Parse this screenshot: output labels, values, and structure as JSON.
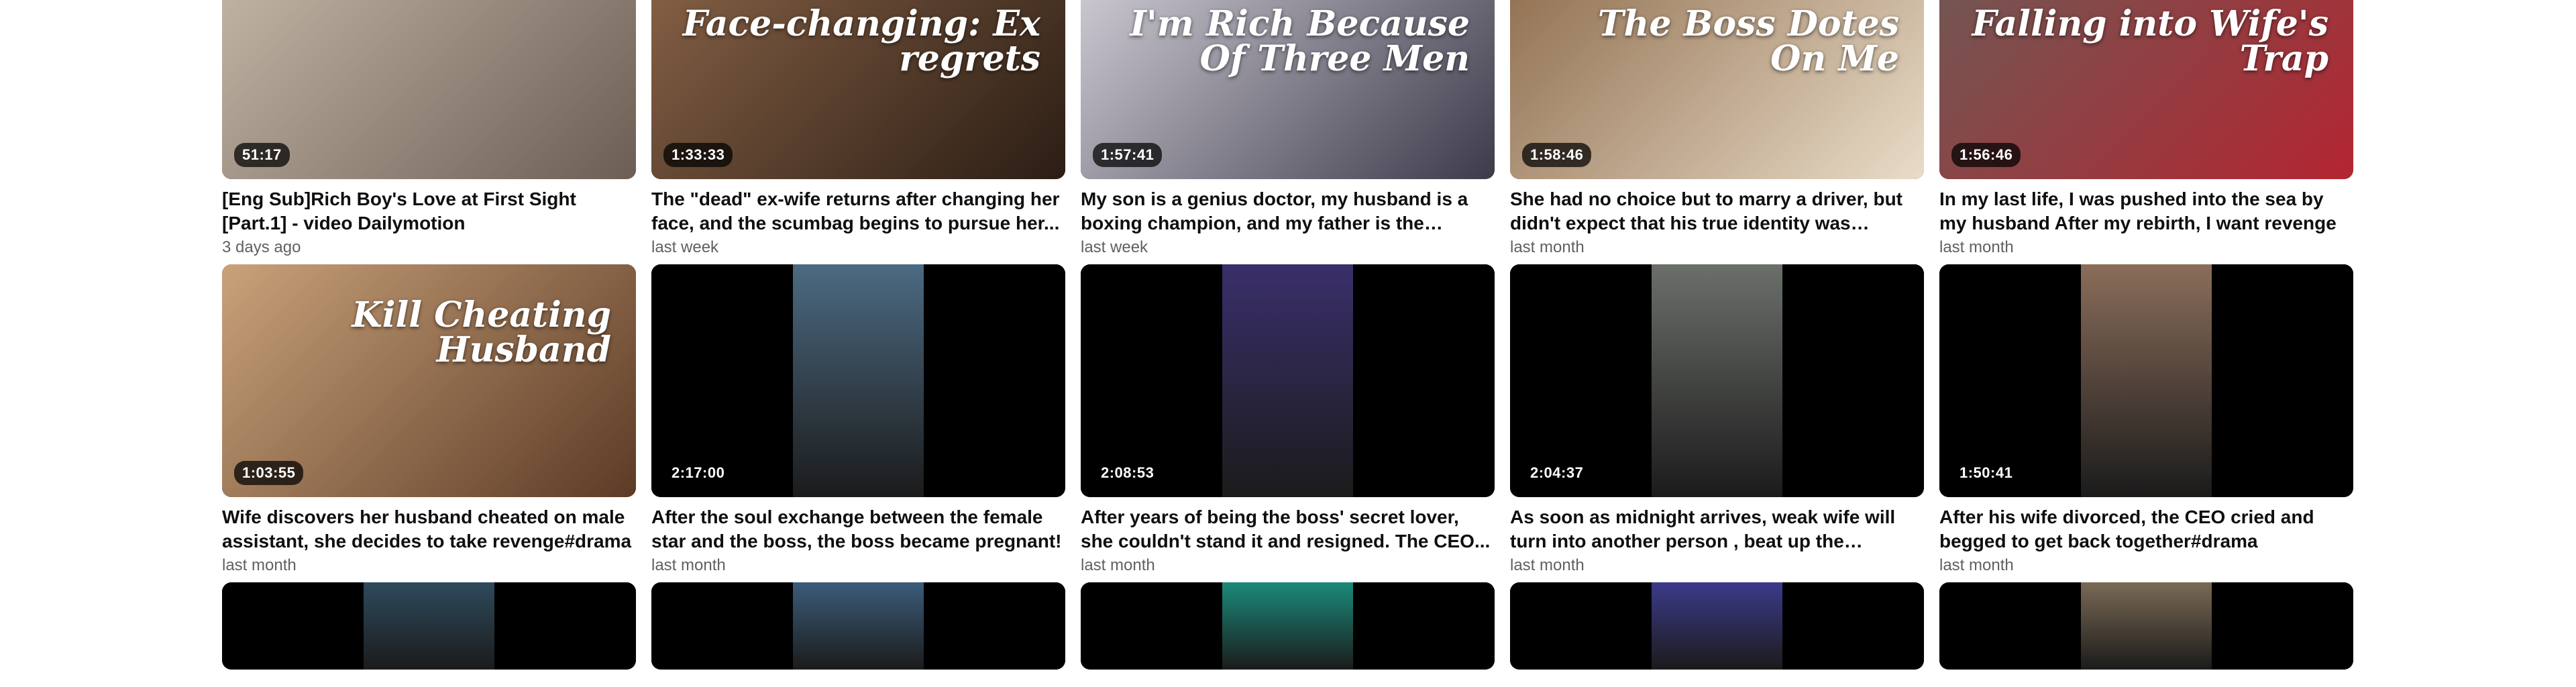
{
  "rows": [
    {
      "cards": [
        {
          "duration": "51:17",
          "title": "[Eng Sub]Rich Boy's Love at First Sight [Part.1] - video Dailymotion",
          "age": "3 days ago",
          "bg": "#c6b9a9",
          "accent": "#6d5e55",
          "overlay": ""
        },
        {
          "duration": "1:33:33",
          "title": "The \"dead\" ex-wife returns after changing her face, and the scumbag begins to pursue her...",
          "age": "last week",
          "bg": "#8a6448",
          "accent": "#2b1d14",
          "overlay": "Face-changing: Ex regrets"
        },
        {
          "duration": "1:57:41",
          "title": "My son is a genius doctor, my husband is a boxing champion, and my father is the richest...",
          "age": "last week",
          "bg": "#d6d3dc",
          "accent": "#3d3a4a",
          "overlay": "I'm Rich Because Of Three Men"
        },
        {
          "duration": "1:58:46",
          "title": "She had no choice but to marry a driver, but didn't expect that his true identity was riches...",
          "age": "last month",
          "bg": "#8c6a4a",
          "accent": "#e9dcc8",
          "overlay": "The Boss Dotes On Me"
        },
        {
          "duration": "1:56:46",
          "title": "In my last life, I was pushed into the sea by my husband After my rebirth, I want revenge",
          "age": "last month",
          "bg": "#6e5a55",
          "accent": "#b32531",
          "overlay": "Falling into Wife's Trap"
        }
      ]
    },
    {
      "cards": [
        {
          "duration": "1:03:55",
          "title": "Wife discovers her husband cheated on male assistant, she decides to take revenge#drama",
          "age": "last month",
          "bg": "#c9a27a",
          "accent": "#5c3b26",
          "overlay": "Kill Cheating Husband"
        },
        {
          "duration": "2:17:00",
          "title": "After the soul exchange between the female star and the boss, the boss became pregnant!",
          "age": "last month",
          "bg": "#000000",
          "accent": "#4b6a82",
          "overlay": ""
        },
        {
          "duration": "2:08:53",
          "title": "After years of being the boss' secret lover, she couldn't stand it and resigned. The CEO...",
          "age": "last month",
          "bg": "#000000",
          "accent": "#3a2f6b",
          "overlay": ""
        },
        {
          "duration": "2:04:37",
          "title": "As soon as midnight arrives, weak wife will turn into another person , beat up the scumbag ex...",
          "age": "last month",
          "bg": "#000000",
          "accent": "#6b6f6a",
          "overlay": ""
        },
        {
          "duration": "1:50:41",
          "title": "After his wife divorced, the CEO cried and begged to get back together#drama",
          "age": "last month",
          "bg": "#000000",
          "accent": "#8a6d5a",
          "overlay": ""
        }
      ]
    },
    {
      "cards": [
        {
          "bg": "#000000",
          "accent": "#2e4a5c"
        },
        {
          "bg": "#000000",
          "accent": "#3b5c7a"
        },
        {
          "bg": "#000000",
          "accent": "#1a8a7a"
        },
        {
          "bg": "#000000",
          "accent": "#3c3a8a"
        },
        {
          "bg": "#000000",
          "accent": "#7a6a55"
        }
      ]
    }
  ]
}
